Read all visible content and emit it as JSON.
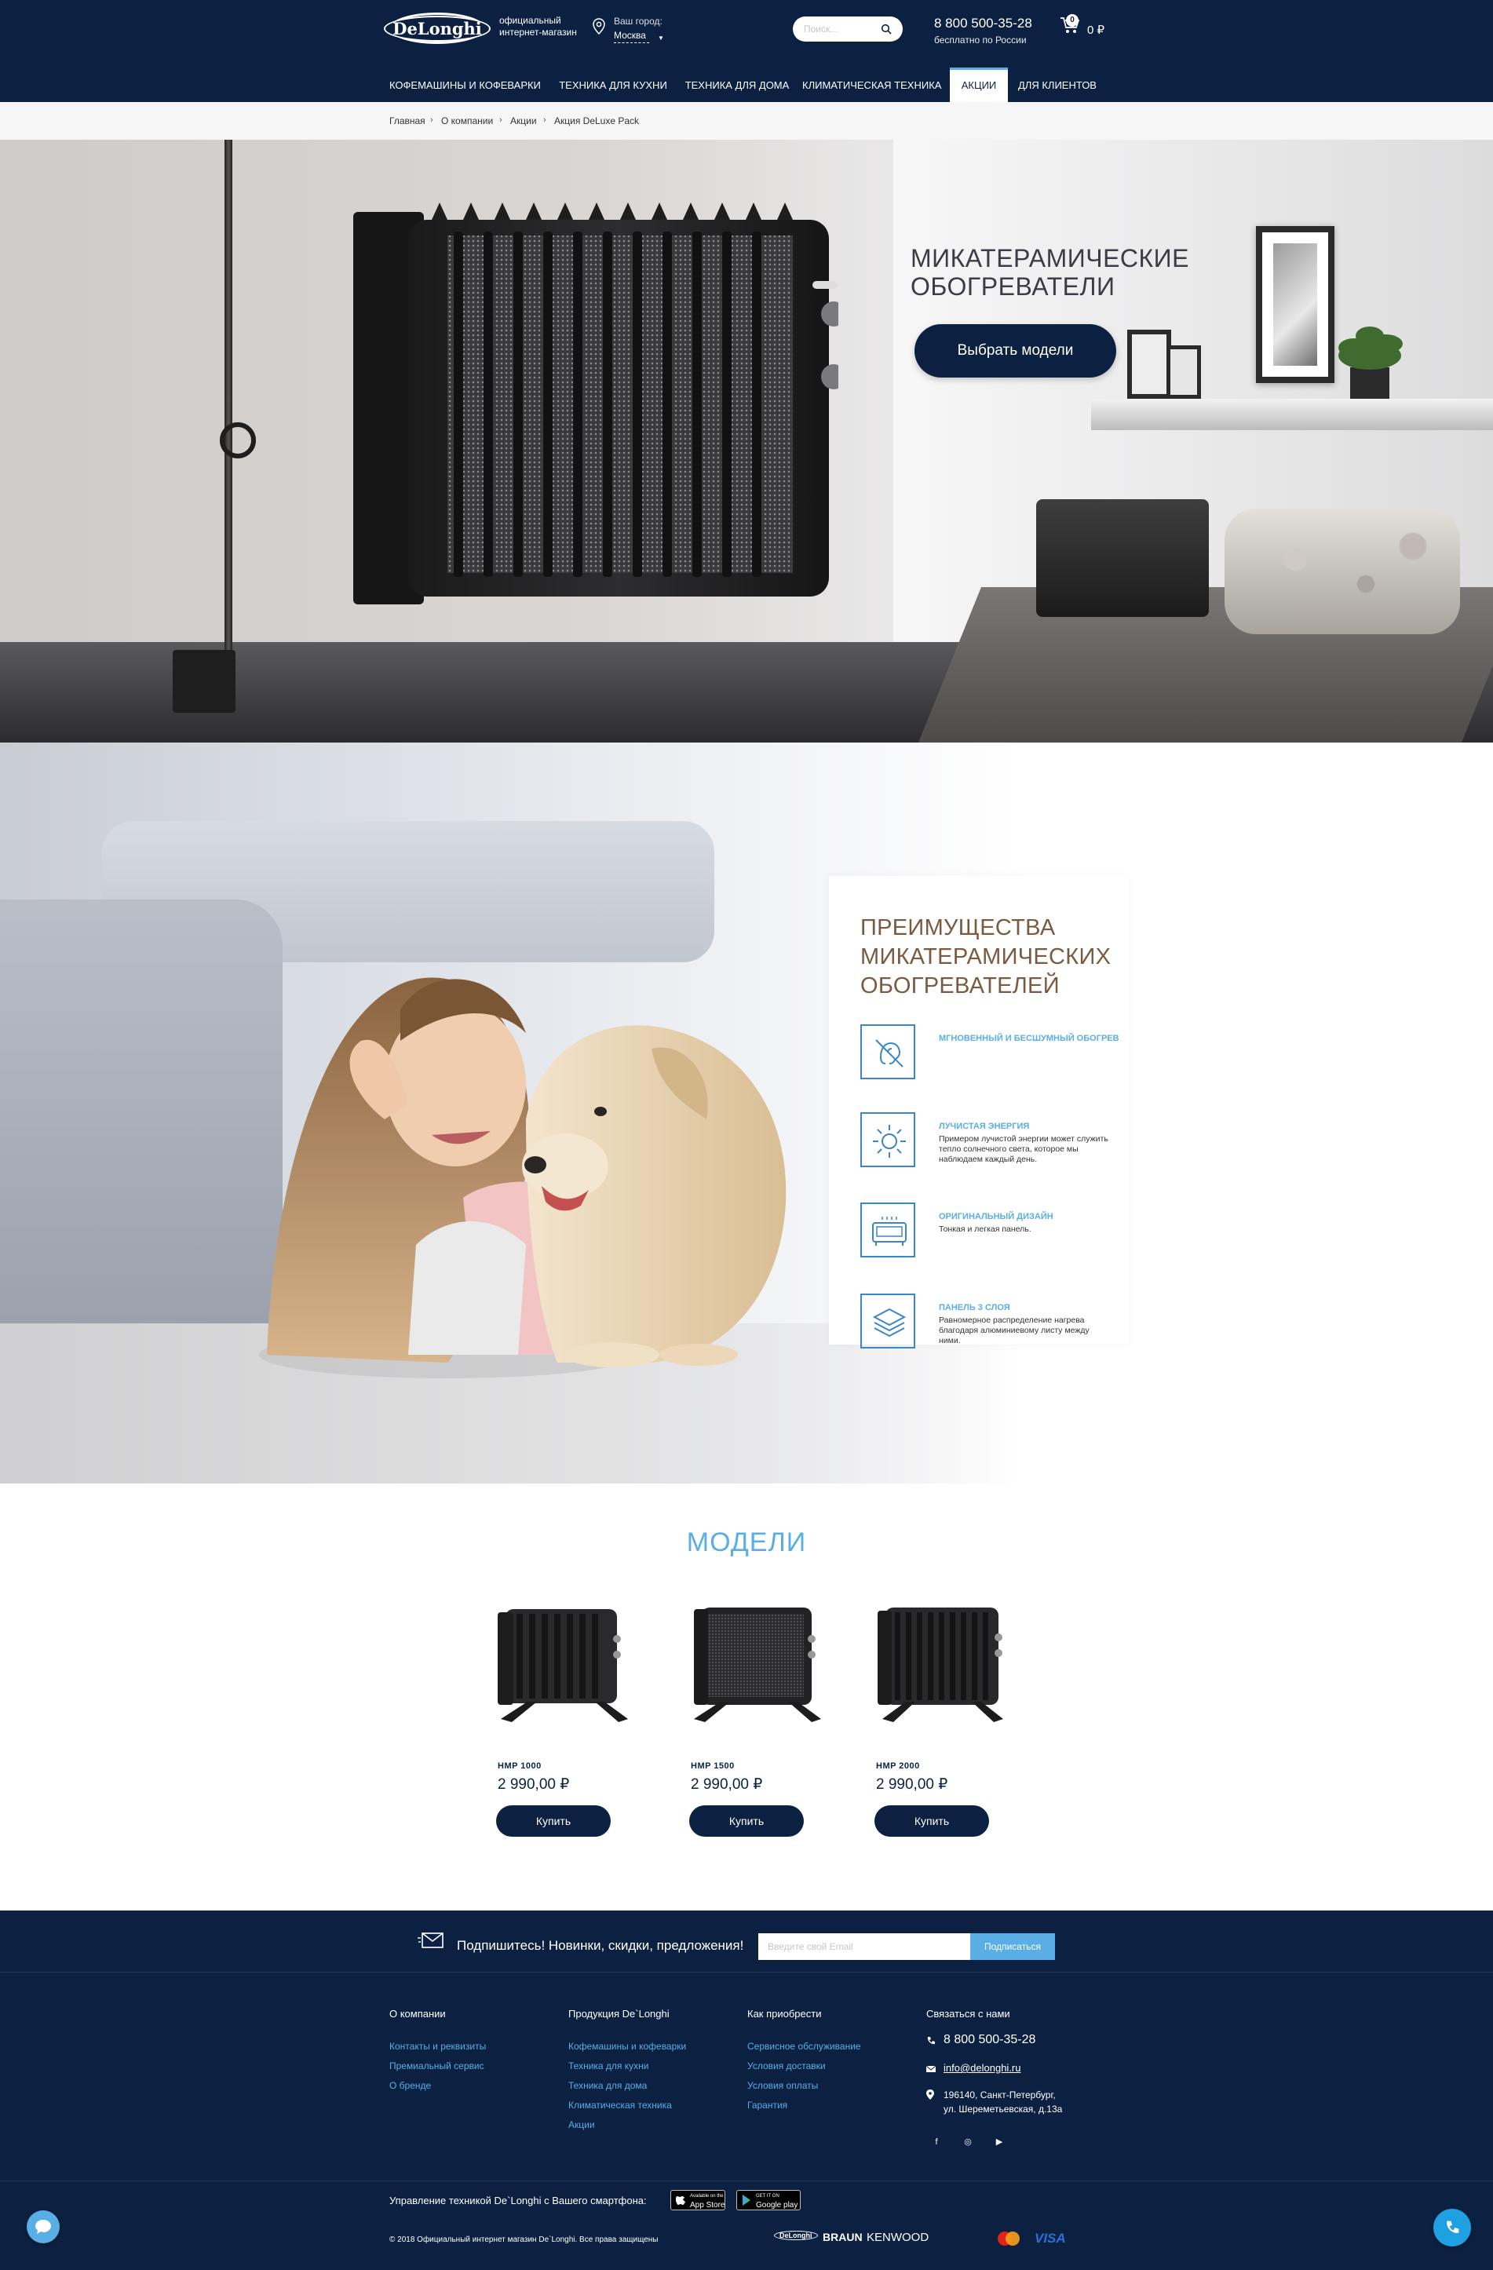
{
  "header": {
    "logo_text": "DeLonghi",
    "official_line1": "официальный",
    "official_line2": "интернет-магазин",
    "city_label": "Ваш город:",
    "city_value": "Москва",
    "search_placeholder": "Поиск...",
    "phone": "8 800 500-35-28",
    "phone_note": "бесплатно по России",
    "cart_count": "0",
    "cart_total": "0 ₽"
  },
  "nav": {
    "items": [
      {
        "label": "КОФЕМАШИНЫ И КОФЕВАРКИ",
        "active": false
      },
      {
        "label": "ТЕХНИКА ДЛЯ КУХНИ",
        "active": false
      },
      {
        "label": "ТЕХНИКА ДЛЯ ДОМА",
        "active": false
      },
      {
        "label": "КЛИМАТИЧЕСКАЯ ТЕХНИКА",
        "active": false
      },
      {
        "label": "АКЦИИ",
        "active": true
      },
      {
        "label": "ДЛЯ КЛИЕНТОВ",
        "active": false
      }
    ]
  },
  "breadcrumb": [
    "Главная",
    "О компании",
    "Акции",
    "Акция DeLuxe Pack"
  ],
  "hero": {
    "title_line1": "МИКАТЕРАМИЧЕСКИЕ",
    "title_line2": "ОБОГРЕВАТЕЛИ",
    "button": "Выбрать модели"
  },
  "advantages": {
    "title_line1": "ПРЕИМУЩЕСТВА",
    "title_line2": "МИКАТЕРАМИЧЕСКИХ",
    "title_line3": "ОБОГРЕВАТЕЛЕЙ",
    "items": [
      {
        "icon": "silent-ear-icon",
        "heading": "Мгновенный и бесшумный обогрев",
        "text": ""
      },
      {
        "icon": "sun-icon",
        "heading": "Лучистая энергия",
        "text": "Примером лучистой энергии может служить тепло солнечного света, которое мы наблюдаем каждый день."
      },
      {
        "icon": "heater-panel-icon",
        "heading": "Оригинальный дизайн",
        "text": "Тонкая и легкая панель."
      },
      {
        "icon": "layers-icon",
        "heading": "Панель 3 слоя",
        "text": "Равномерное распределение нагрева благодаря алюминиевому листу между ними."
      }
    ]
  },
  "models": {
    "title": "МОДЕЛИ",
    "products": [
      {
        "name": "HMP 1000",
        "price": "2 990,00 ₽",
        "button": "Купить"
      },
      {
        "name": "HMP 1500",
        "price": "2 990,00 ₽",
        "button": "Купить"
      },
      {
        "name": "HMP 2000",
        "price": "2 990,00 ₽",
        "button": "Купить"
      }
    ]
  },
  "footer": {
    "subscribe_text": "Подпишитесь! Новинки, скидки, предложения!",
    "subscribe_placeholder": "Введите свой Email",
    "subscribe_button": "Подписаться",
    "columns": [
      {
        "heading": "О компании",
        "links": [
          "Контакты и реквизиты",
          "Премиальный сервис",
          "О бренде"
        ]
      },
      {
        "heading": "Продукция De`Longhi",
        "links": [
          "Кофемашины и кофеварки",
          "Техника для кухни",
          "Техника для дома",
          "Климатическая техника",
          "Акции"
        ]
      },
      {
        "heading": "Как приобрести",
        "links": [
          "Сервисное обслуживание",
          "Условия доставки",
          "Условия оплаты",
          "Гарантия"
        ]
      }
    ],
    "contacts_heading": "Связаться с нами",
    "contact_phone": "8 800 500-35-28",
    "contact_email": "info@delonghi.ru",
    "address_line1": "196140, Санкт-Петербург,",
    "address_line2": "ул. Шереметьевская, д.13а",
    "social": [
      "f",
      "◎",
      "▶"
    ],
    "app_text": "Управление техникой De`Longhi с Вашего смартфона:",
    "app_store_line1": "Available on the",
    "app_store_line2": "App Store",
    "google_play_line1": "GET IT ON",
    "google_play_line2": "Google play",
    "copyright": "© 2018 Официальный интернет магазин De`Longhi. Все права защищены",
    "brands": [
      "DeLonghi",
      "BRAUN",
      "KENWOOD"
    ],
    "payment": [
      "mastercard",
      "VISA"
    ]
  },
  "colors": {
    "navy": "#0c2141",
    "accent_blue": "#5aaee6",
    "advantage_title": "#7a5b40"
  }
}
